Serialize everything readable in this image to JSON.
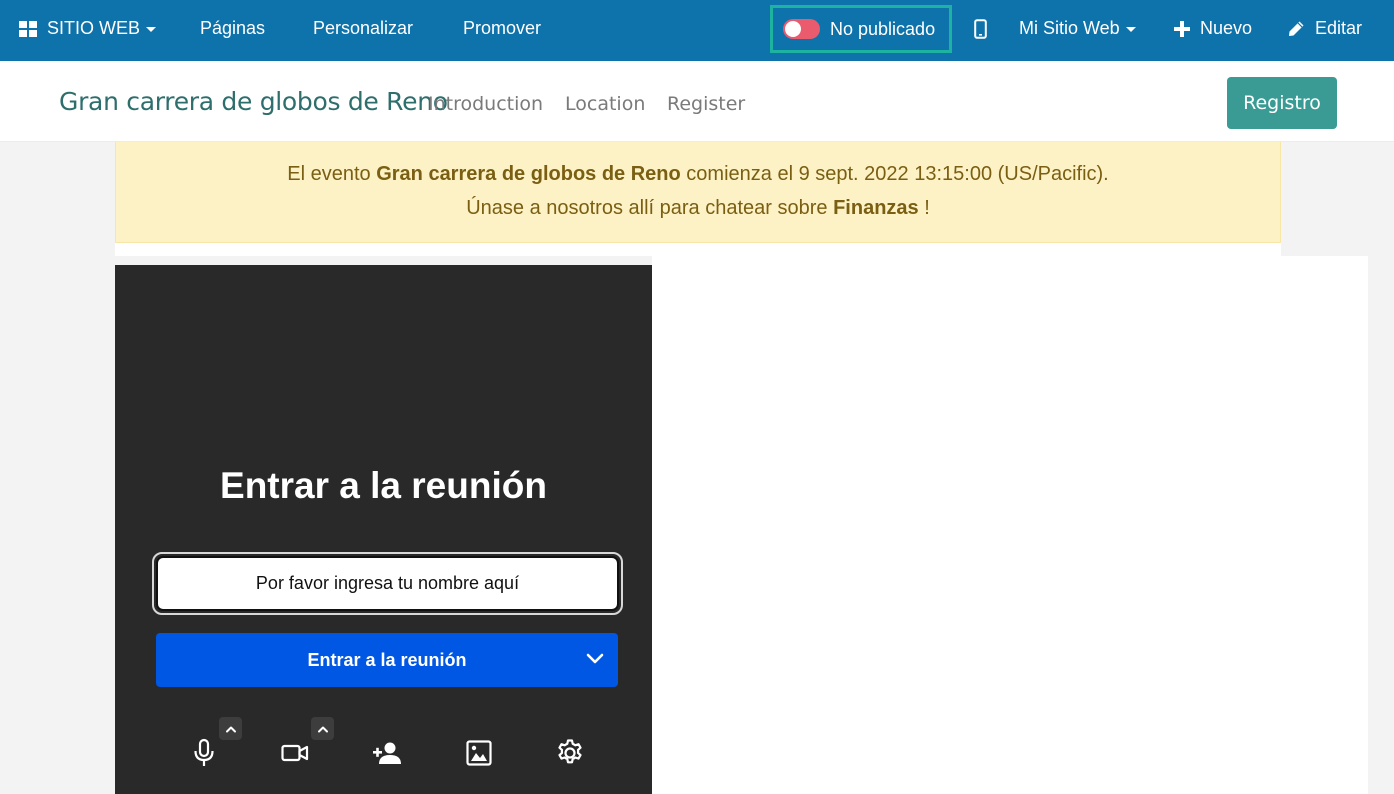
{
  "topbar": {
    "website_menu": "SITIO WEB",
    "pages": "Páginas",
    "customize": "Personalizar",
    "promote": "Promover",
    "publish_status": "No publicado",
    "my_site": "Mi Sitio Web",
    "new": "Nuevo",
    "edit": "Editar"
  },
  "header": {
    "site_title": "Gran carrera de globos de Reno",
    "nav": [
      "Introduction",
      "Location",
      "Register"
    ],
    "register_button": "Registro"
  },
  "alert": {
    "prefix": "El evento ",
    "event_name": "Gran carrera de globos de Reno",
    "middle": " comienza el 9 sept. 2022 13:15:00 (US/Pacific).",
    "line2_prefix": "Únase a nosotros allí para chatear sobre ",
    "topic": "Finanzas",
    "line2_suffix": " !"
  },
  "meeting": {
    "title": "Entrar a la reunión",
    "name_placeholder": "Por favor ingresa tu nombre aquí",
    "join_button": "Entrar a la reunión"
  },
  "colors": {
    "topbar_bg": "#0e72ab",
    "publish_highlight": "#1eb3a0",
    "toggle_off": "#e95b6d",
    "register_button": "#3a9b95",
    "alert_bg": "#fdf2c6",
    "meeting_bg": "#292929",
    "join_button": "#0057e4"
  }
}
